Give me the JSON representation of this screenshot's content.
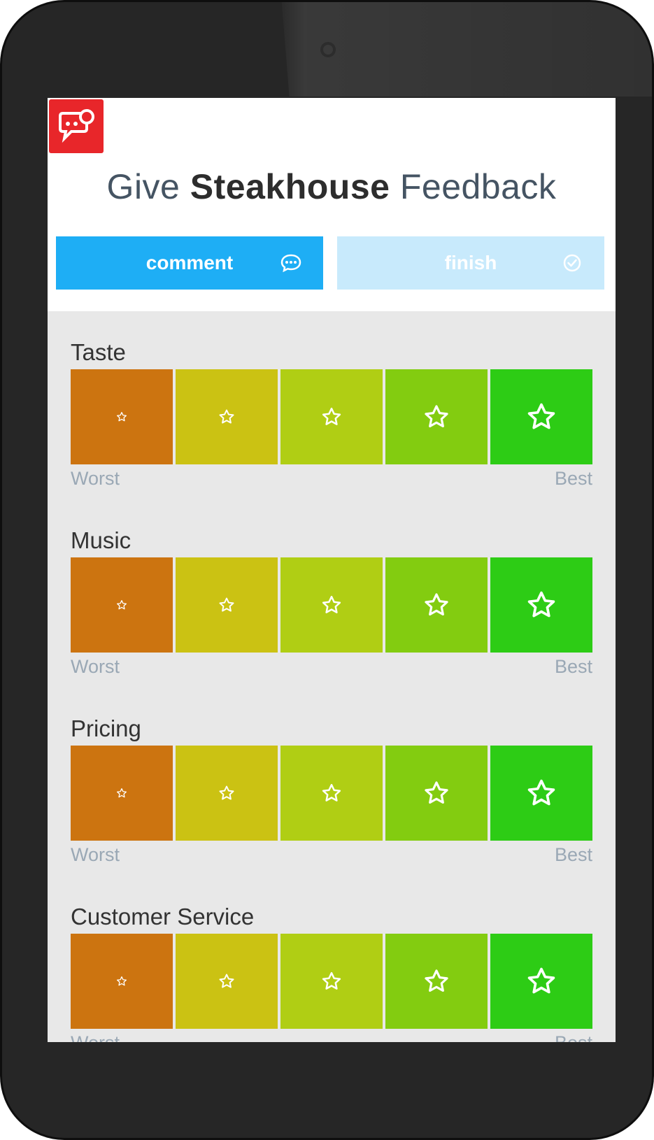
{
  "header": {
    "title_prefix": "Give",
    "title_bold": "Steakhouse",
    "title_suffix": "Feedback",
    "logo_icon": "chat-bubble-icon"
  },
  "buttons": {
    "comment": {
      "label": "comment",
      "icon": "speech-bubble-icon",
      "color": "#1eaef5"
    },
    "finish": {
      "label": "finish",
      "icon": "check-circle-icon",
      "color": "#c8eafc"
    }
  },
  "rating_colors": [
    "#cc7410",
    "#cbc213",
    "#b0ce14",
    "#83cc10",
    "#2dcc15"
  ],
  "scale": {
    "low": "Worst",
    "high": "Best"
  },
  "sections": [
    {
      "label": "Taste"
    },
    {
      "label": "Music"
    },
    {
      "label": "Pricing"
    },
    {
      "label": "Customer Service"
    }
  ]
}
